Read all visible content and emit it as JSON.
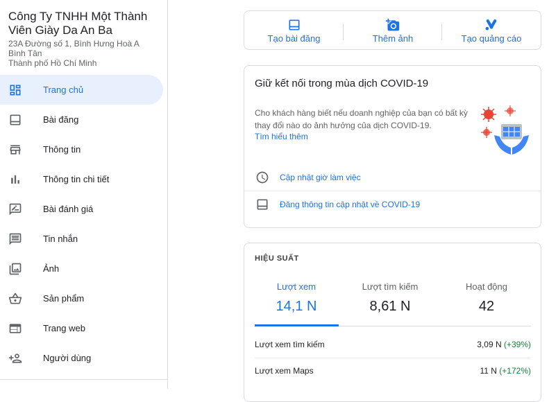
{
  "business": {
    "name": "Công Ty TNHH Một Thành Viên Giày Da An Ba",
    "address_line1": "23A Đường số 1, Bình Hưng Hoà A",
    "address_line2": "Bình Tân",
    "address_line3": "Thành phố Hồ Chí Minh"
  },
  "sidebar": {
    "items": [
      {
        "label": "Trang chủ",
        "icon": "dashboard-icon",
        "active": true
      },
      {
        "label": "Bài đăng",
        "icon": "post-icon"
      },
      {
        "label": "Thông tin",
        "icon": "store-icon"
      },
      {
        "label": "Thông tin chi tiết",
        "icon": "bar-chart-icon"
      },
      {
        "label": "Bài đánh giá",
        "icon": "rate-review-icon"
      },
      {
        "label": "Tin nhắn",
        "icon": "message-icon"
      },
      {
        "label": "Ảnh",
        "icon": "photo-library-icon"
      },
      {
        "label": "Sản phẩm",
        "icon": "basket-icon"
      },
      {
        "label": "Trang web",
        "icon": "web-icon"
      },
      {
        "label": "Người dùng",
        "icon": "person-add-icon"
      }
    ]
  },
  "actions": {
    "create_post": "Tạo bài đăng",
    "add_photo": "Thêm ảnh",
    "create_ad": "Tạo quảng cáo"
  },
  "covid": {
    "title": "Giữ kết nối trong mùa dịch COVID-19",
    "body": "Cho khách hàng biết nếu doanh nghiệp của bạn có bất kỳ thay đổi nào do ảnh hưởng của dịch COVID-19.",
    "learn_more": "Tìm hiểu thêm",
    "update_hours": "Cập nhật giờ làm việc",
    "post_update": "Đăng thông tin cập nhật về COVID-19"
  },
  "performance": {
    "title": "HIỆU SUẤT",
    "tabs": [
      {
        "label": "Lượt xem",
        "value": "14,1 N",
        "active": true
      },
      {
        "label": "Lượt tìm kiếm",
        "value": "8,61 N"
      },
      {
        "label": "Hoạt động",
        "value": "42"
      }
    ],
    "rows": [
      {
        "label": "Lượt xem tìm kiếm",
        "value": "3,09 N",
        "change": "(+39%)"
      },
      {
        "label": "Lượt xem Maps",
        "value": "11 N",
        "change": "(+172%)"
      }
    ]
  },
  "colors": {
    "accent": "#1a73e8",
    "positive": "#188038",
    "active_bg": "#e8f0fe"
  }
}
